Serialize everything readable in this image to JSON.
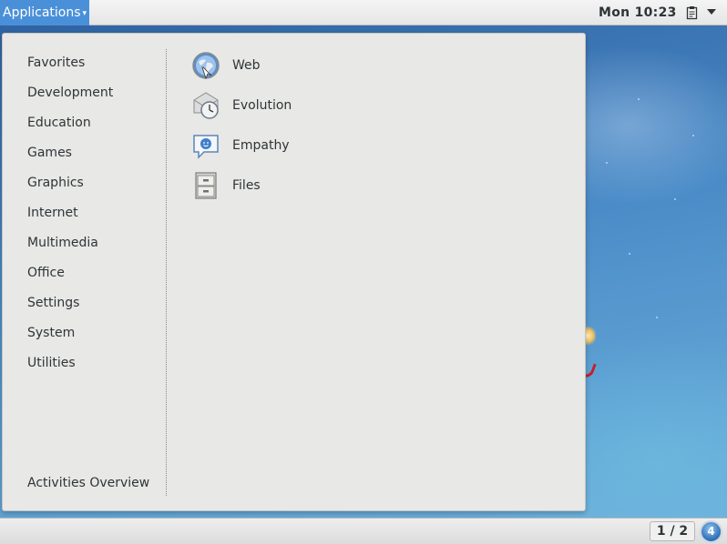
{
  "topbar": {
    "apps_label": "Applications",
    "apps_arrow": "▾",
    "clock": "Mon 10:23",
    "clipboard_icon": "clipboard-icon",
    "system_menu_icon": "chevron-down-icon"
  },
  "menu": {
    "categories": [
      {
        "label": "Favorites"
      },
      {
        "label": "Development"
      },
      {
        "label": "Education"
      },
      {
        "label": "Games"
      },
      {
        "label": "Graphics"
      },
      {
        "label": "Internet"
      },
      {
        "label": "Multimedia"
      },
      {
        "label": "Office"
      },
      {
        "label": "Settings"
      },
      {
        "label": "System"
      },
      {
        "label": "Utilities"
      }
    ],
    "activities_label": "Activities Overview",
    "apps": [
      {
        "label": "Web",
        "icon": "web-browser-icon"
      },
      {
        "label": "Evolution",
        "icon": "evolution-mail-icon"
      },
      {
        "label": "Empathy",
        "icon": "empathy-chat-icon"
      },
      {
        "label": "Files",
        "icon": "file-cabinet-icon"
      }
    ]
  },
  "bottombar": {
    "workspace": "1 / 2",
    "notification_count": "4"
  },
  "colors": {
    "accent": "#4a90d9",
    "menu_bg": "#e8e8e7",
    "text": "#2e3436"
  }
}
